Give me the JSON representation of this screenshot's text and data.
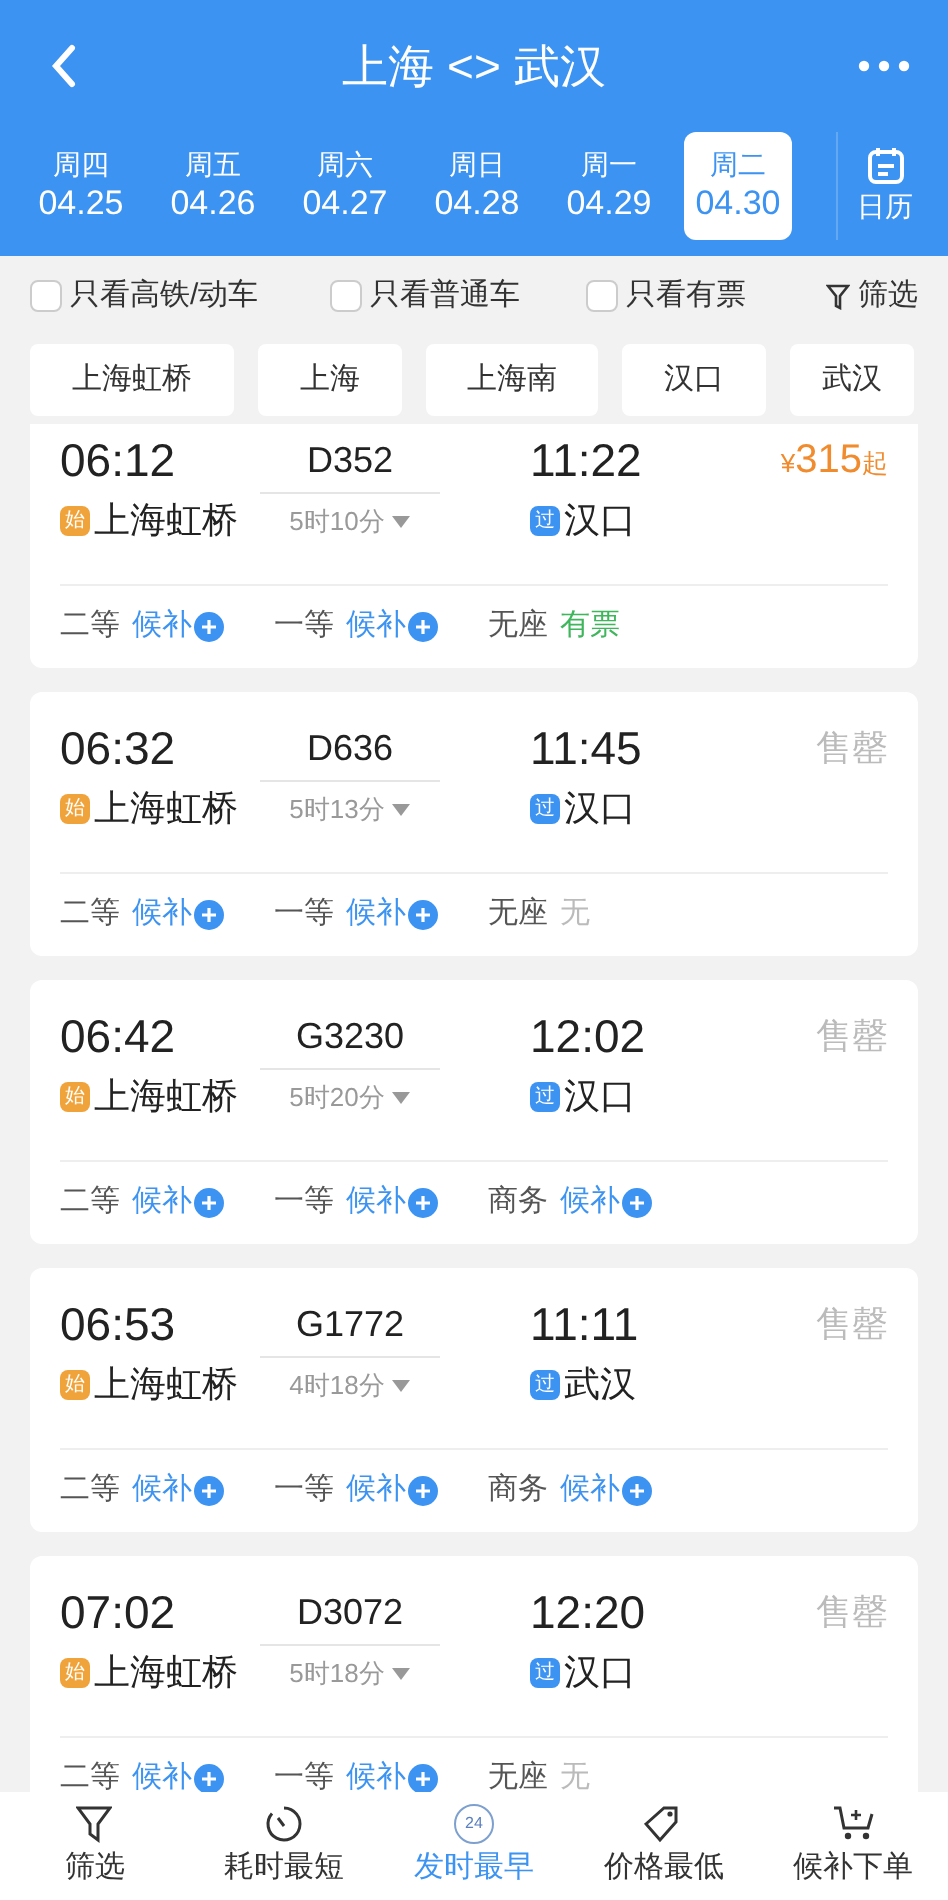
{
  "header": {
    "title": "上海 <> 武汉"
  },
  "dates": [
    {
      "weekday": "周四",
      "date": "04.25",
      "selected": false
    },
    {
      "weekday": "周五",
      "date": "04.26",
      "selected": false
    },
    {
      "weekday": "周六",
      "date": "04.27",
      "selected": false
    },
    {
      "weekday": "周日",
      "date": "04.28",
      "selected": false
    },
    {
      "weekday": "周一",
      "date": "04.29",
      "selected": false
    },
    {
      "weekday": "周二",
      "date": "04.30",
      "selected": true
    }
  ],
  "calendar_button": "日历",
  "filters": [
    {
      "label": "只看高铁/动车",
      "checked": false
    },
    {
      "label": "只看普通车",
      "checked": false
    },
    {
      "label": "只看有票",
      "checked": false
    }
  ],
  "filter_button": "筛选",
  "stations": [
    {
      "label": "上海虹桥",
      "selected": false
    },
    {
      "label": "上海",
      "selected": false
    },
    {
      "label": "上海南",
      "selected": false
    },
    {
      "label": "汉口",
      "selected": false
    },
    {
      "label": "武汉",
      "selected": false
    }
  ],
  "trains": [
    {
      "depart": "06:12",
      "train_no": "D352",
      "arrive": "11:22",
      "from_badge": "始",
      "from": "上海虹桥",
      "duration": "5时10分",
      "to_badge": "过",
      "to": "汉口",
      "fare": {
        "kind": "price",
        "currency": "¥",
        "amount": "315",
        "suffix": "起"
      },
      "seats": [
        {
          "label": "二等",
          "status": "候补",
          "kind": "waitlist"
        },
        {
          "label": "一等",
          "status": "候补",
          "kind": "waitlist"
        },
        {
          "label": "无座",
          "status": "有票",
          "kind": "available"
        }
      ]
    },
    {
      "depart": "06:32",
      "train_no": "D636",
      "arrive": "11:45",
      "from_badge": "始",
      "from": "上海虹桥",
      "duration": "5时13分",
      "to_badge": "过",
      "to": "汉口",
      "fare": {
        "kind": "soldout",
        "text": "售罄"
      },
      "seats": [
        {
          "label": "二等",
          "status": "候补",
          "kind": "waitlist"
        },
        {
          "label": "一等",
          "status": "候补",
          "kind": "waitlist"
        },
        {
          "label": "无座",
          "status": "无",
          "kind": "none"
        }
      ]
    },
    {
      "depart": "06:42",
      "train_no": "G3230",
      "arrive": "12:02",
      "from_badge": "始",
      "from": "上海虹桥",
      "duration": "5时20分",
      "to_badge": "过",
      "to": "汉口",
      "fare": {
        "kind": "soldout",
        "text": "售罄"
      },
      "seats": [
        {
          "label": "二等",
          "status": "候补",
          "kind": "waitlist"
        },
        {
          "label": "一等",
          "status": "候补",
          "kind": "waitlist"
        },
        {
          "label": "商务",
          "status": "候补",
          "kind": "waitlist"
        }
      ]
    },
    {
      "depart": "06:53",
      "train_no": "G1772",
      "arrive": "11:11",
      "from_badge": "始",
      "from": "上海虹桥",
      "duration": "4时18分",
      "to_badge": "过",
      "to": "武汉",
      "fare": {
        "kind": "soldout",
        "text": "售罄"
      },
      "seats": [
        {
          "label": "二等",
          "status": "候补",
          "kind": "waitlist"
        },
        {
          "label": "一等",
          "status": "候补",
          "kind": "waitlist"
        },
        {
          "label": "商务",
          "status": "候补",
          "kind": "waitlist"
        }
      ]
    },
    {
      "depart": "07:02",
      "train_no": "D3072",
      "arrive": "12:20",
      "from_badge": "始",
      "from": "上海虹桥",
      "duration": "5时18分",
      "to_badge": "过",
      "to": "汉口",
      "fare": {
        "kind": "soldout",
        "text": "售罄"
      },
      "seats": [
        {
          "label": "二等",
          "status": "候补",
          "kind": "waitlist"
        },
        {
          "label": "一等",
          "status": "候补",
          "kind": "waitlist"
        },
        {
          "label": "无座",
          "status": "无",
          "kind": "none"
        }
      ]
    }
  ],
  "bottom_nav": [
    {
      "label": "筛选",
      "kind": "filter",
      "selected": false
    },
    {
      "label": "耗时最短",
      "kind": "timer",
      "selected": false
    },
    {
      "label": "发时最早",
      "kind": "clock24",
      "selected": true,
      "icon_text": "24"
    },
    {
      "label": "价格最低",
      "kind": "tag",
      "selected": false
    },
    {
      "label": "候补下单",
      "kind": "cart",
      "selected": false
    }
  ]
}
